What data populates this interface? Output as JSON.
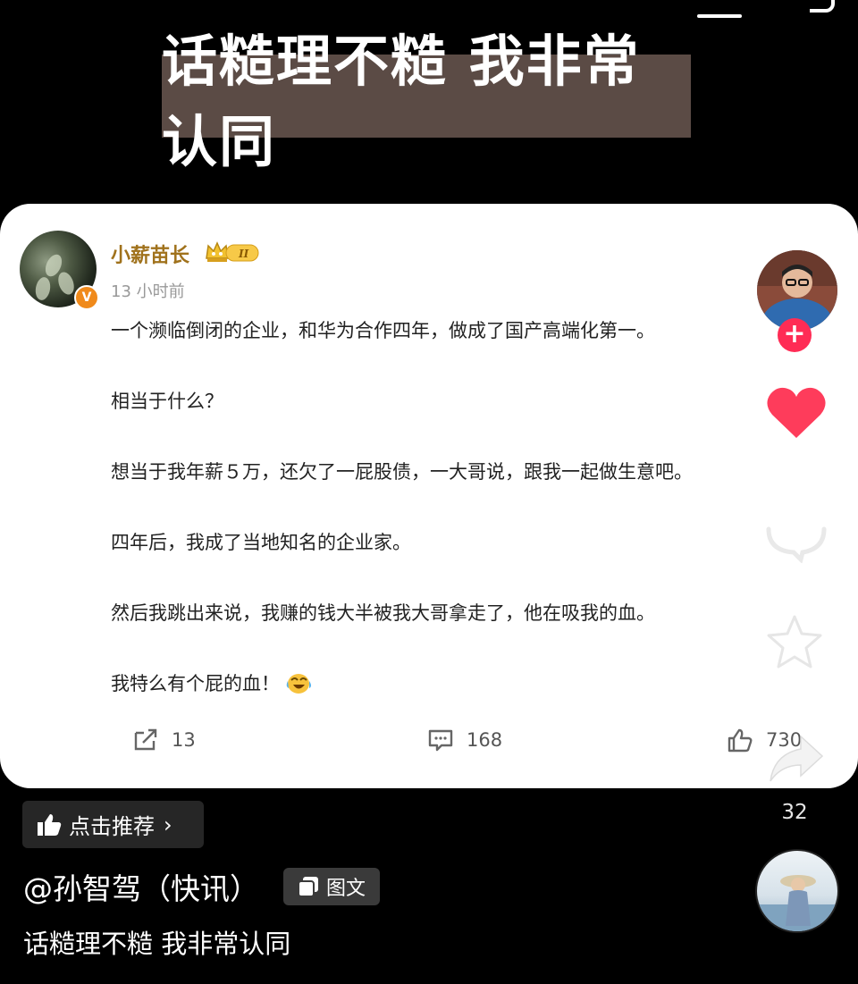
{
  "headline": "话糙理不糙 我非常认同",
  "post": {
    "author": "小薪苗长",
    "level_badge": "II",
    "time": "13 小时前",
    "paragraphs": [
      "一个濒临倒闭的企业，和华为合作四年，做成了国产高端化第一。",
      "相当于什么？",
      "想当于我年薪５万，还欠了一屁股债，一大哥说，跟我一起做生意吧。",
      "四年后，我成了当地知名的企业家。",
      "然后我跳出来说，我赚的钱大半被我大哥拿走了，他在吸我的血。",
      "我特么有个屁的血！"
    ],
    "reposts": "13",
    "comments": "168",
    "likes": "730"
  },
  "side": {
    "share_count": "32"
  },
  "recommend_label": "点击推荐",
  "username": "@孙智驾（快讯）",
  "type_badge": "图文",
  "caption": "话糙理不糙 我非常认同",
  "colors": {
    "background": "#000000",
    "headline_bg": "#5b4b45",
    "author": "#a0721c",
    "like_red": "#ff2c55"
  },
  "icons": [
    "search-icon",
    "verified-icon",
    "crown-badge-icon",
    "laugh-cry-emoji",
    "repost-icon",
    "comment-icon",
    "like-icon",
    "follow-plus-icon",
    "heart-icon",
    "star-icon",
    "share-icon",
    "thumb-icon",
    "chevron-right-icon",
    "image-text-icon"
  ]
}
